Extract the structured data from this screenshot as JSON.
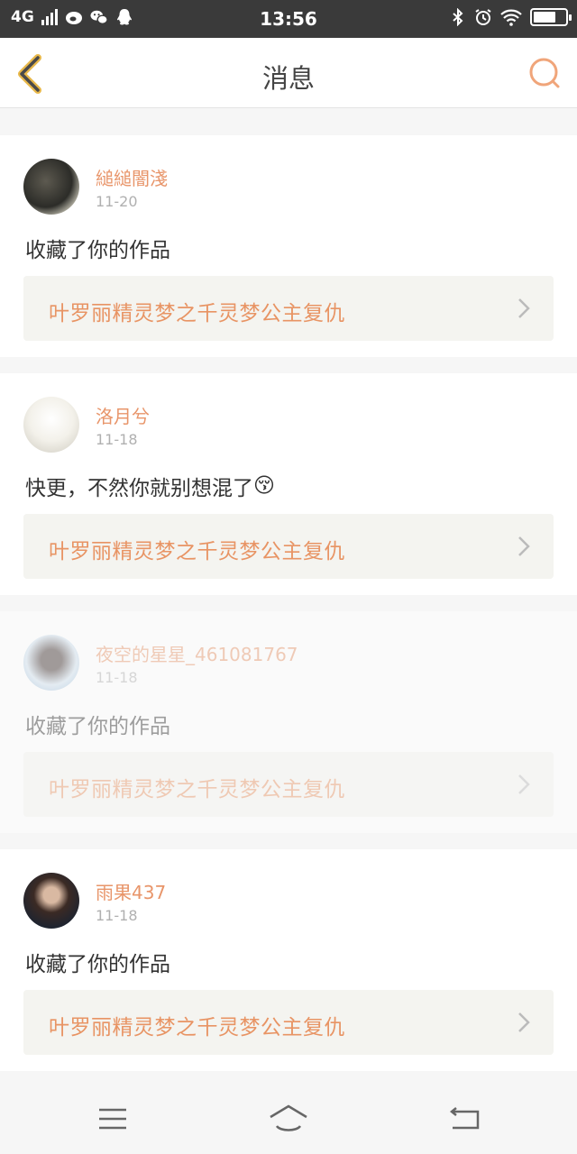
{
  "status_bar": {
    "network": "4G",
    "time": "13:56",
    "icons": [
      "signal-icon",
      "weibo-icon",
      "wechat-icon",
      "qq-icon",
      "bluetooth-icon",
      "alarm-icon",
      "wifi-icon",
      "battery-icon"
    ],
    "battery_level": 0.7
  },
  "header": {
    "title": "消息",
    "back_icon": "chevron-left-icon",
    "search_icon": "search-icon"
  },
  "messages": [
    {
      "username": "縋縋闇淺",
      "date": "11-20",
      "text": "收藏了你的作品",
      "emoji": "",
      "work_title": "叶罗丽精灵梦之千灵梦公主复仇"
    },
    {
      "username": "洛月兮",
      "date": "11-18",
      "text": "快更，不然你就别想混了",
      "emoji": "😚",
      "work_title": "叶罗丽精灵梦之千灵梦公主复仇"
    },
    {
      "username": "夜空的星星_461081767",
      "date": "11-18",
      "text": "收藏了你的作品",
      "emoji": "",
      "work_title": "叶罗丽精灵梦之千灵梦公主复仇"
    },
    {
      "username": "雨果437",
      "date": "11-18",
      "text": "收藏了你的作品",
      "emoji": "",
      "work_title": "叶罗丽精灵梦之千灵梦公主复仇"
    }
  ],
  "colors": {
    "accent": "#e8956a",
    "status_bar": "#3a3a3a",
    "card_bg": "#ffffff",
    "work_bg": "#f4f4f0"
  },
  "bottom_nav": [
    "menu-icon",
    "home-icon",
    "back-icon"
  ]
}
